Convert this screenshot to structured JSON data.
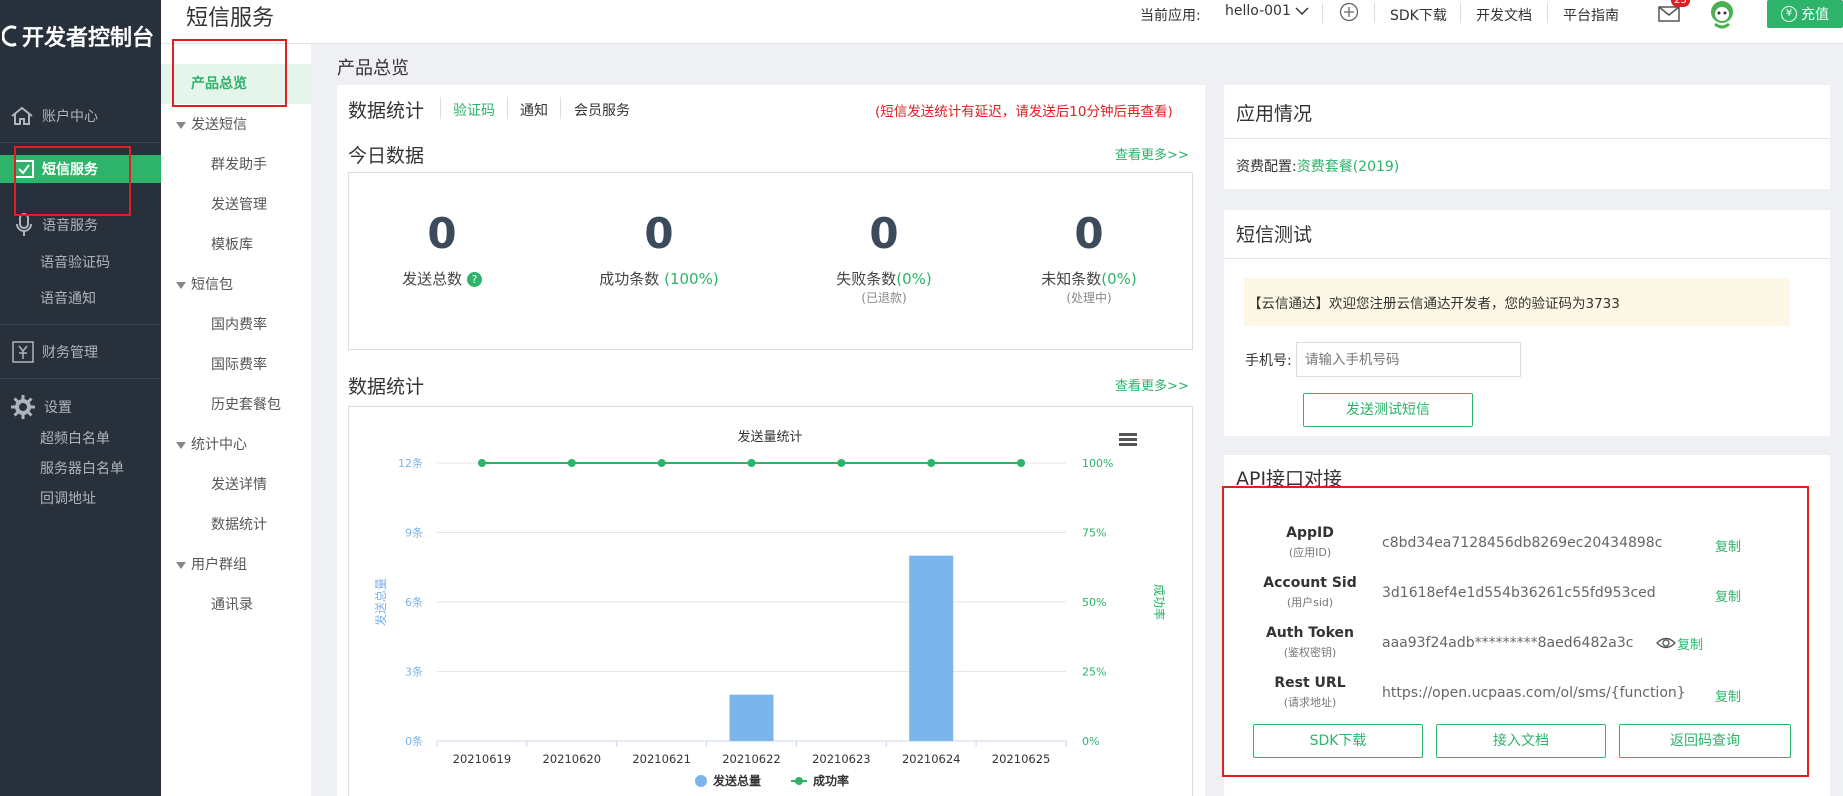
{
  "app": {
    "logo_text": "开发者控制台",
    "page_title": "短信服务"
  },
  "header": {
    "current_app_label": "当前应用:",
    "current_app_value": "hello-001",
    "links": [
      "SDK下载",
      "开发文档",
      "平台指南"
    ],
    "mail_badge": "23",
    "recharge_label": "充值",
    "recharge_currency": "¥"
  },
  "sidebar": {
    "items": [
      {
        "label": "账户中心",
        "icon": "home-icon"
      },
      {
        "label": "短信服务",
        "icon": "sms-icon",
        "active": true
      },
      {
        "label": "语音服务",
        "icon": "mic-icon",
        "children": [
          "语音验证码",
          "语音通知"
        ]
      },
      {
        "label": "财务管理",
        "icon": "finance-icon"
      },
      {
        "label": "设置",
        "icon": "gear-icon",
        "children": [
          "超频白名单",
          "服务器白名单",
          "回调地址"
        ]
      }
    ]
  },
  "subnav": {
    "active": "产品总览",
    "groups": [
      {
        "title": "发送短信",
        "items": [
          "群发助手",
          "发送管理",
          "模板库"
        ]
      },
      {
        "title": "短信包",
        "items": [
          "国内费率",
          "国际费率",
          "历史套餐包"
        ]
      },
      {
        "title": "统计中心",
        "items": [
          "发送详情",
          "数据统计"
        ]
      },
      {
        "title": "用户群组",
        "items": [
          "通讯录"
        ]
      }
    ]
  },
  "main": {
    "breadcrumb": "产品总览",
    "stats_title": "数据统计",
    "tabs": [
      "验证码",
      "通知",
      "会员服务"
    ],
    "delay_notice": "(短信发送统计有延迟，请发送后10分钟后再查看)",
    "today_title": "今日数据",
    "more_link": "查看更多>>",
    "today_stats": [
      {
        "value": "0",
        "label": "发送总数",
        "extra": "",
        "sub": ""
      },
      {
        "value": "0",
        "label": "成功条数",
        "extra": "(100%)",
        "sub": ""
      },
      {
        "value": "0",
        "label": "失败条数",
        "extra": "(0%)",
        "sub": "(已退款)"
      },
      {
        "value": "0",
        "label": "未知条数",
        "extra": "(0%)",
        "sub": "(处理中)"
      }
    ],
    "chart_section_title": "数据统计"
  },
  "chart_data": {
    "type": "bar",
    "title": "发送量统计",
    "categories": [
      "20210619",
      "20210620",
      "20210621",
      "20210622",
      "20210623",
      "20210624",
      "20210625"
    ],
    "series": [
      {
        "name": "发送总量",
        "type": "bar",
        "axis": "left",
        "values": [
          0,
          0,
          0,
          2,
          0,
          8,
          0
        ],
        "color": "#7cb5ec"
      },
      {
        "name": "成功率",
        "type": "line",
        "axis": "right",
        "values": [
          100,
          100,
          100,
          100,
          100,
          100,
          100
        ],
        "color": "#2db36a"
      }
    ],
    "ylabel": "发送总量",
    "y2label": "成功率",
    "ylim": [
      0,
      12
    ],
    "y2lim": [
      0,
      100
    ],
    "yticks": [
      "0条",
      "3条",
      "6条",
      "9条",
      "12条"
    ],
    "y2ticks": [
      "0%",
      "25%",
      "50%",
      "75%",
      "100%"
    ],
    "legend": "bottom-center",
    "grid": true
  },
  "right": {
    "app_title": "应用情况",
    "plan_label": "资费配置:",
    "plan_value": "资费套餐(2019)",
    "sms_test_title": "短信测试",
    "sms_test_message": "【云信通达】欢迎您注册云信通达开发者，您的验证码为3733",
    "phone_label": "手机号:",
    "phone_placeholder": "请输入手机号码",
    "send_test_button": "发送测试短信",
    "api_title": "API接口对接",
    "api_rows": [
      {
        "label": "AppID",
        "sub": "(应用ID)",
        "value": "c8bd34ea7128456db8269ec20434898c",
        "action": "复制"
      },
      {
        "label": "Account Sid",
        "sub": "(用户sid)",
        "value": "3d1618ef4e1d554b36261c55fd953ced",
        "action": "复制"
      },
      {
        "label": "Auth Token",
        "sub": "(鉴权密钥)",
        "value": "aaa93f24adb*********8aed6482a3c",
        "action": "复制"
      },
      {
        "label": "Rest URL",
        "sub": "(请求地址)",
        "value": "https://open.ucpaas.com/ol/sms/{function}",
        "action": "复制"
      }
    ],
    "api_buttons": [
      "SDK下载",
      "接入文档",
      "返回码查询"
    ]
  },
  "colors": {
    "accent": "#2db36a",
    "sidebar_bg": "#28303b",
    "notice": "#e02020",
    "bar": "#7cb5ec"
  }
}
